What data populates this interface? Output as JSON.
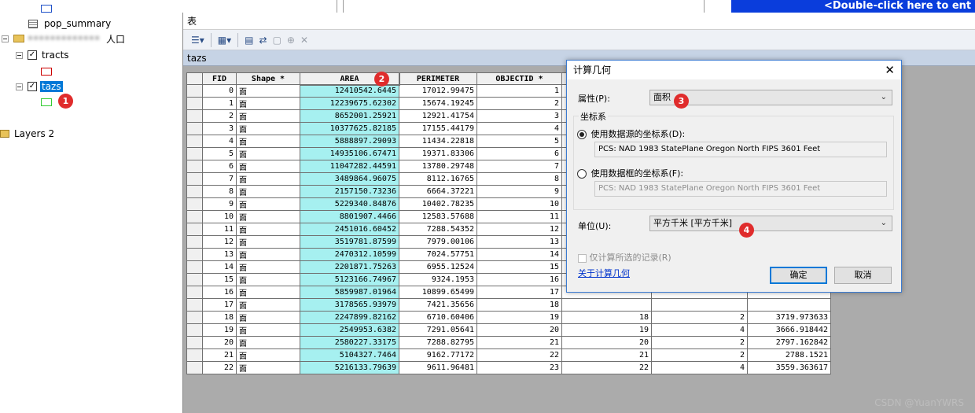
{
  "toc": {
    "pop_summary_label": "pop_summary",
    "group_label_blurred": "•••••••••••••",
    "group_label_suffix": "人口",
    "tracts_label": "tracts",
    "tazs_label": "tazs",
    "layers2_label": "Layers 2",
    "tracts_color": "#cc0000",
    "tazs_color": "#33cc33",
    "pop_summary_color": "#1e50c8",
    "badge_1": "1"
  },
  "right_window": {
    "title": "<Double-click here to ent"
  },
  "table_window": {
    "title": "表",
    "tab_label": "tazs",
    "badge_2": "2",
    "columns": [
      "FID",
      "Shape *",
      "AREA",
      "PERIMETER",
      "OBJECTID *",
      "",
      "",
      ""
    ],
    "rows": [
      [
        "0",
        "面",
        "12410542.6445",
        "17012.99475",
        "1",
        "",
        "",
        ""
      ],
      [
        "1",
        "面",
        "12239675.62302",
        "15674.19245",
        "2",
        "",
        "",
        ""
      ],
      [
        "2",
        "面",
        "8652001.25921",
        "12921.41754",
        "3",
        "",
        "",
        ""
      ],
      [
        "3",
        "面",
        "10377625.82185",
        "17155.44179",
        "4",
        "",
        "",
        ""
      ],
      [
        "4",
        "面",
        "5888897.29093",
        "11434.22818",
        "5",
        "",
        "",
        ""
      ],
      [
        "5",
        "面",
        "14935106.67471",
        "19371.83306",
        "6",
        "",
        "",
        ""
      ],
      [
        "6",
        "面",
        "11047282.44591",
        "13780.29748",
        "7",
        "",
        "",
        ""
      ],
      [
        "7",
        "面",
        "3489864.96075",
        "8112.16765",
        "8",
        "",
        "",
        ""
      ],
      [
        "8",
        "面",
        "2157150.73236",
        "6664.37221",
        "9",
        "",
        "",
        ""
      ],
      [
        "9",
        "面",
        "5229340.84876",
        "10402.78235",
        "10",
        "",
        "",
        ""
      ],
      [
        "10",
        "面",
        "8801907.4466",
        "12583.57688",
        "11",
        "",
        "",
        ""
      ],
      [
        "11",
        "面",
        "2451016.60452",
        "7288.54352",
        "12",
        "",
        "",
        ""
      ],
      [
        "12",
        "面",
        "3519781.87599",
        "7979.00106",
        "13",
        "",
        "",
        ""
      ],
      [
        "13",
        "面",
        "2470312.10599",
        "7024.57751",
        "14",
        "",
        "",
        ""
      ],
      [
        "14",
        "面",
        "2201871.75263",
        "6955.12524",
        "15",
        "",
        "",
        ""
      ],
      [
        "15",
        "面",
        "5123166.74967",
        "9324.1953",
        "16",
        "",
        "",
        ""
      ],
      [
        "16",
        "面",
        "5859987.01964",
        "10899.65499",
        "17",
        "",
        "",
        ""
      ],
      [
        "17",
        "面",
        "3178565.93979",
        "7421.35656",
        "18",
        "",
        "",
        ""
      ],
      [
        "18",
        "面",
        "2247899.82162",
        "6710.60406",
        "19",
        "18",
        "2",
        "3719.973633"
      ],
      [
        "19",
        "面",
        "2549953.6382",
        "7291.05641",
        "20",
        "19",
        "4",
        "3666.918442"
      ],
      [
        "20",
        "面",
        "2580227.33175",
        "7288.82795",
        "21",
        "20",
        "2",
        "2797.162842"
      ],
      [
        "21",
        "面",
        "5104327.7464",
        "9162.77172",
        "22",
        "21",
        "2",
        "2788.1521"
      ],
      [
        "22",
        "面",
        "5216133.79639",
        "9611.96481",
        "23",
        "22",
        "4",
        "3559.363617"
      ]
    ]
  },
  "dialog": {
    "title": "计算几何",
    "close_glyph": "✕",
    "property_label": "属性(P):",
    "property_value": "面积",
    "badge_3": "3",
    "cs_group_label": "坐标系",
    "cs_option_source": "使用数据源的坐标系(D):",
    "cs_source_value": "PCS: NAD 1983 StatePlane Oregon North FIPS 3601 Feet",
    "cs_option_frame": "使用数据框的坐标系(F):",
    "cs_frame_value": "PCS: NAD 1983 StatePlane Oregon North FIPS 3601 Feet",
    "units_label": "单位(U):",
    "units_value": "平方千米 [平方千米]",
    "badge_4": "4",
    "selected_only_label": "仅计算所选的记录(R)",
    "about_link": "关于计算几何",
    "ok_label": "确定",
    "cancel_label": "取消"
  },
  "watermark": "CSDN @YuanYWRS",
  "colors": {
    "area_column": "#a6f0f0",
    "badge": "#e02c2c",
    "right_titlebar": "#0a3ddc"
  }
}
